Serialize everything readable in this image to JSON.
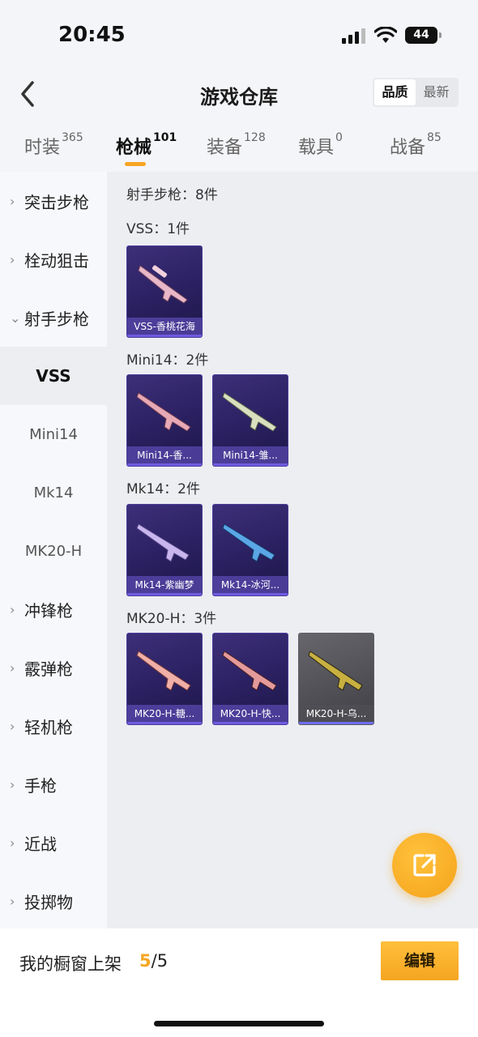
{
  "status": {
    "time": "20:45",
    "battery": "44"
  },
  "nav": {
    "title": "游戏仓库",
    "sort_options": [
      "品质",
      "最新"
    ]
  },
  "tabs": [
    {
      "label": "时装",
      "count": "365"
    },
    {
      "label": "枪械",
      "count": "101"
    },
    {
      "label": "装备",
      "count": "128"
    },
    {
      "label": "载具",
      "count": "0"
    },
    {
      "label": "战备",
      "count": "85"
    }
  ],
  "sidebar": {
    "categories": [
      "突击步枪",
      "栓动狙击",
      "射手步枪"
    ],
    "subitems": [
      "VSS",
      "Mini14",
      "Mk14",
      "MK20-H"
    ],
    "more": [
      "冲锋枪",
      "霰弹枪",
      "轻机枪",
      "手枪",
      "近战",
      "投掷物"
    ]
  },
  "content": {
    "header": "射手步枪：8件",
    "groups": [
      {
        "title": "VSS：1件",
        "items": [
          "VSS-香桃花海"
        ]
      },
      {
        "title": "Mini14：2件",
        "items": [
          "Mini14-香...",
          "Mini14-雏..."
        ]
      },
      {
        "title": "Mk14：2件",
        "items": [
          "Mk14-紫幽梦",
          "Mk14-冰河..."
        ]
      },
      {
        "title": "MK20-H：3件",
        "items": [
          "MK20-H-糖...",
          "MK20-H-快...",
          "MK20-H-乌..."
        ]
      }
    ]
  },
  "bottom": {
    "shelf_label": "我的橱窗上架",
    "current": "5",
    "total": "/5",
    "edit_label": "编辑"
  },
  "colors": {
    "accent": "#f5a623",
    "card": "#2a2060"
  },
  "icons": {
    "back": "chevron-left-icon",
    "fab": "share-external-icon"
  }
}
